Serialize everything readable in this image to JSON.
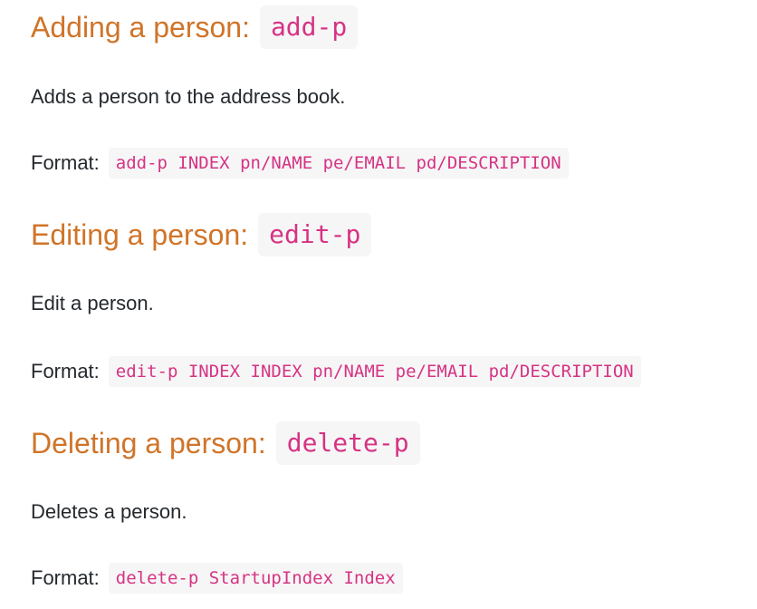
{
  "sections": [
    {
      "title": "Adding a person:",
      "command": "add-p",
      "description": "Adds a person to the address book.",
      "format_label": "Format:",
      "format": "add-p INDEX pn/NAME pe/EMAIL pd/DESCRIPTION"
    },
    {
      "title": "Editing a person:",
      "command": "edit-p",
      "description": "Edit a person.",
      "format_label": "Format:",
      "format": "edit-p INDEX INDEX pn/NAME pe/EMAIL pd/DESCRIPTION"
    },
    {
      "title": "Deleting a person:",
      "command": "delete-p",
      "description": "Deletes a person.",
      "format_label": "Format:",
      "format": "delete-p StartupIndex Index"
    }
  ],
  "colors": {
    "heading": "#d07429",
    "code_text": "#d63384",
    "code_background": "#f6f6f6",
    "body_text": "#24292e"
  }
}
